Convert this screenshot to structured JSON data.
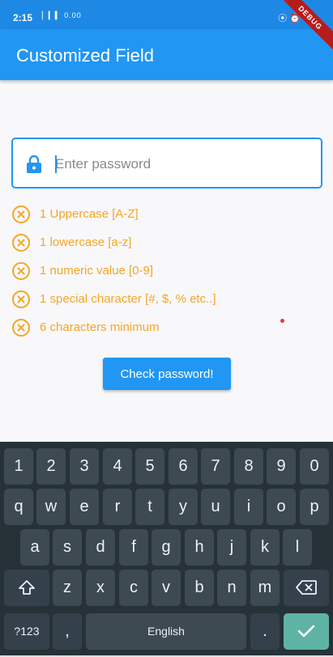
{
  "status_bar": {
    "time": "2:15",
    "left_icons": "▏▎▍ 0.00",
    "right_icons": "⦿ ⏰"
  },
  "debug_ribbon": "DEBUG",
  "app_bar": {
    "title": "Customized Field"
  },
  "password_field": {
    "placeholder": "Enter password",
    "value": ""
  },
  "rules": [
    "1 Uppercase [A-Z]",
    "1 lowercase [a-z]",
    "1 numeric value [0-9]",
    "1 special character [#, $, % etc..]",
    "6 characters minimum"
  ],
  "check_button": "Check password!",
  "keyboard": {
    "row_numbers": [
      "1",
      "2",
      "3",
      "4",
      "5",
      "6",
      "7",
      "8",
      "9",
      "0"
    ],
    "row_1": [
      "q",
      "w",
      "e",
      "r",
      "t",
      "y",
      "u",
      "i",
      "o",
      "p"
    ],
    "row_2": [
      "a",
      "s",
      "d",
      "f",
      "g",
      "h",
      "j",
      "k",
      "l"
    ],
    "row_3": [
      "z",
      "x",
      "c",
      "v",
      "b",
      "n",
      "m"
    ],
    "symbols": "?123",
    "comma": ",",
    "space": "English",
    "period": ".",
    "shift_icon": "shift-icon",
    "backspace_icon": "backspace-icon",
    "enter_icon": "check-icon"
  },
  "colors": {
    "app_bar": "#2196f3",
    "rule_warning": "#f5a623",
    "keyboard_bg": "#263238",
    "enter_key": "#5fb3a4"
  }
}
